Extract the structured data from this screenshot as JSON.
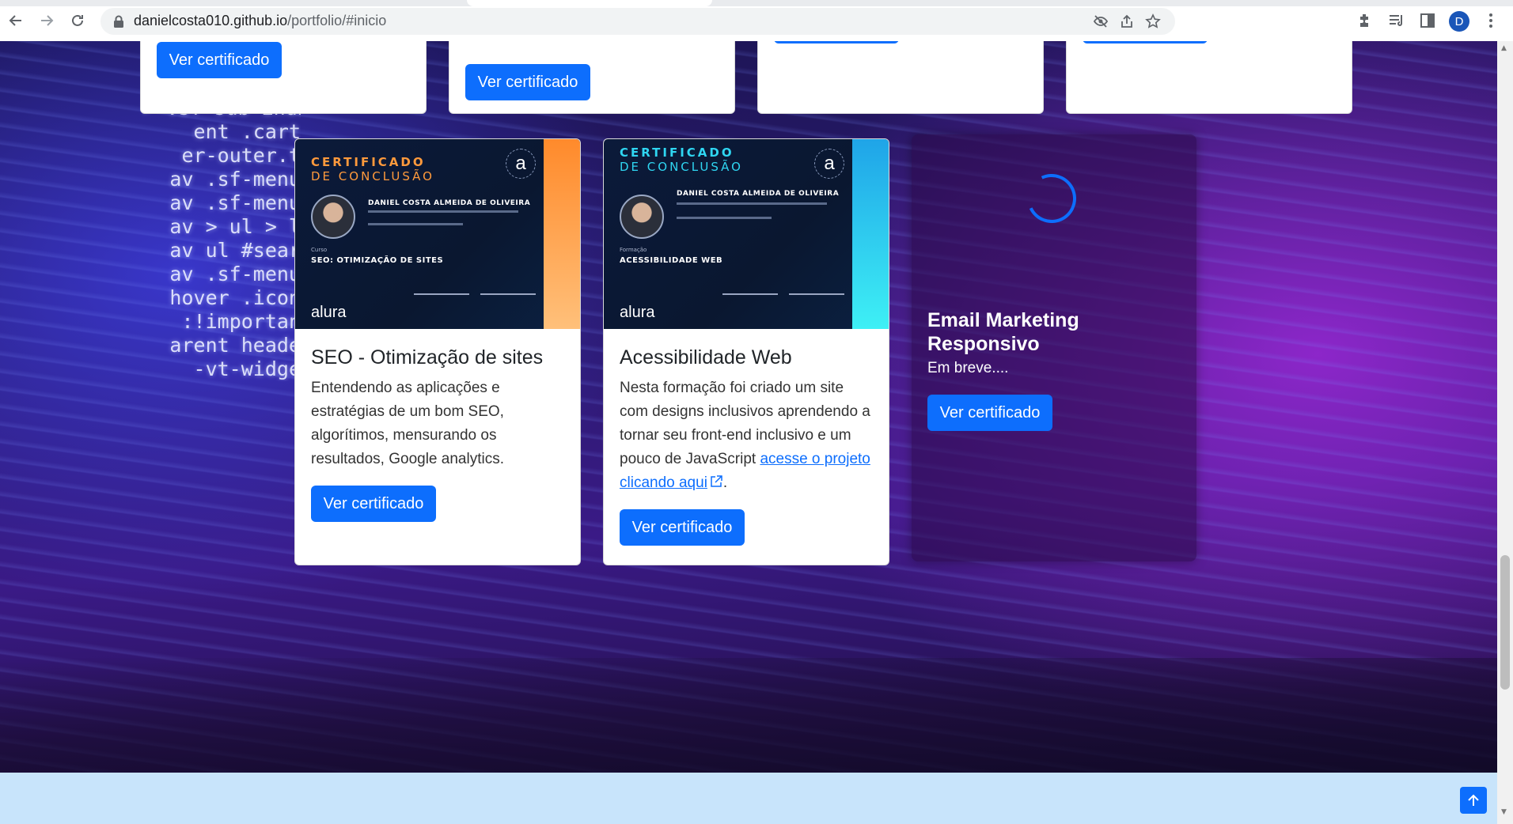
{
  "browser": {
    "url_host": "danielcosta010.github.io",
    "url_path": "/portfolio/#inicio",
    "profile_initial": "D"
  },
  "top_cards": [
    {
      "button": "Ver certificado"
    },
    {
      "button": "Ver certificado"
    },
    {
      "button": ""
    },
    {
      "button": ""
    }
  ],
  "code_lines": [
    "  > .sf-sub-indica",
    "ent .cart",
    "er-outer.t",
    "av .sf-menu",
    "av .sf-menu",
    "av > ul > l",
    "av ul #sear",
    "av .sf-menu",
    "hover .icon",
    ":!importan",
    "arent heade",
    "-vt-widge"
  ],
  "cards": [
    {
      "cert_heading_1": "CERTIFICADO",
      "cert_heading_2": "DE CONCLUSÃO",
      "cert_name": "DANIEL COSTA ALMEIDA DE OLIVEIRA",
      "cert_course_label": "Curso",
      "cert_course": "SEO: OTIMIZAÇÃO DE SITES",
      "cert_logo": "alura",
      "title": "SEO - Otimização de sites",
      "text": "Entendendo as aplicações e estratégias de um bom SEO, algorítimos, mensurando os resultados, Google analytics.",
      "button": "Ver certificado",
      "accent": "#ff9a3c"
    },
    {
      "cert_heading_1": "CERTIFICADO",
      "cert_heading_2": "DE CONCLUSÃO",
      "cert_name": "DANIEL COSTA ALMEIDA DE OLIVEIRA",
      "cert_course_label": "Formação",
      "cert_course": "ACESSIBILIDADE WEB",
      "cert_logo": "alura",
      "title": "Acessibilidade Web",
      "text_before": "Nesta formação foi criado um site com designs inclusivos aprendendo a tornar seu front-end inclusivo e um pouco de JavaScript ",
      "link": "acesse o projeto clicando aqui",
      "text_after": ".",
      "button": "Ver certificado",
      "accent": "#2fd6f2"
    }
  ],
  "coming_soon": {
    "title": "Email Marketing Responsivo",
    "text": "Em breve....",
    "button": "Ver certificado"
  },
  "colors": {
    "primary": "#0d6efd",
    "footer": "#c8e4fb"
  }
}
